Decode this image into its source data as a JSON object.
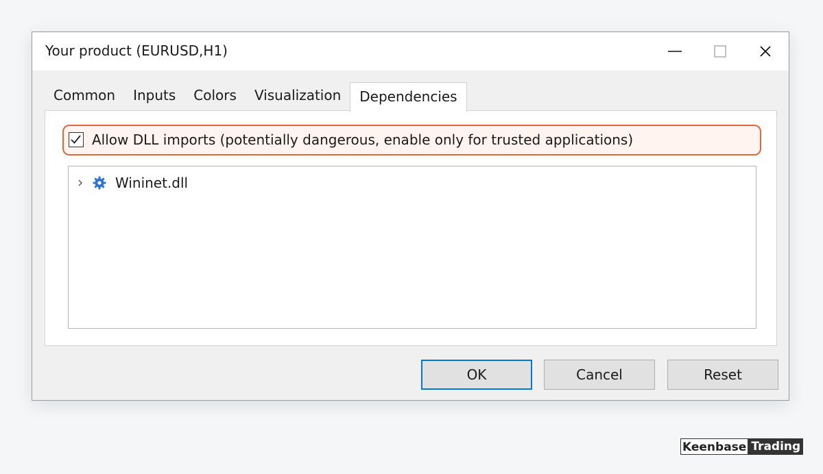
{
  "window": {
    "title": "Your product (EURUSD,H1)",
    "controls": {
      "minimize": "minimize-icon",
      "maximize": "maximize-icon",
      "close": "close-icon"
    }
  },
  "tabs": [
    {
      "label": "Common",
      "active": false
    },
    {
      "label": "Inputs",
      "active": false
    },
    {
      "label": "Colors",
      "active": false
    },
    {
      "label": "Visualization",
      "active": false
    },
    {
      "label": "Dependencies",
      "active": true
    }
  ],
  "dependencies": {
    "allow_dll": {
      "checked": true,
      "label": "Allow DLL imports (potentially dangerous, enable only for trusted applications)",
      "highlight_color": "#e0683a"
    },
    "tree": [
      {
        "label": "Wininet.dll",
        "icon": "gear-icon",
        "expanded": false,
        "icon_color": "#2f74d0"
      }
    ]
  },
  "buttons": {
    "ok": "OK",
    "cancel": "Cancel",
    "reset": "Reset"
  },
  "watermark": {
    "part1": "Keenbase",
    "part2": "Trading"
  }
}
